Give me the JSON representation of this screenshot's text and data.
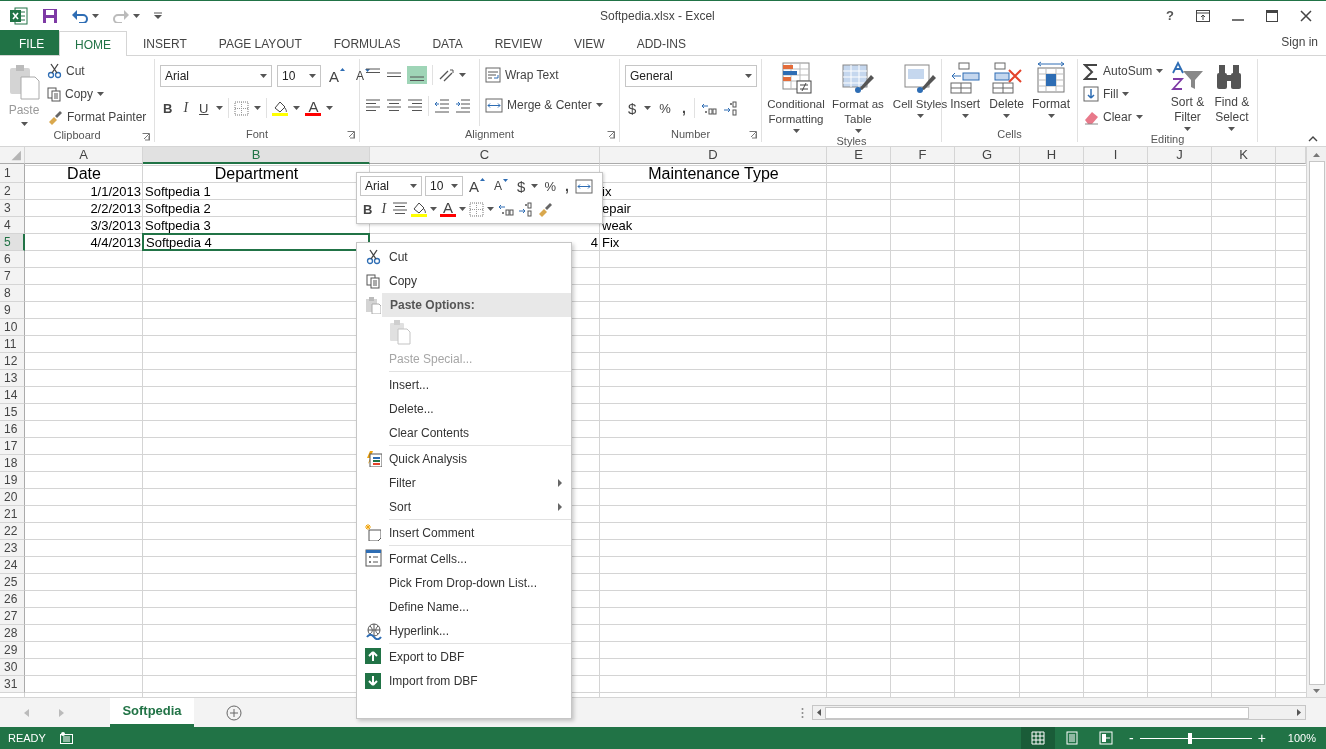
{
  "window": {
    "title": "Softpedia.xlsx - Excel",
    "help": "?"
  },
  "ribbon_tabs": [
    {
      "label": "FILE",
      "kind": "file",
      "selected": false
    },
    {
      "label": "HOME",
      "kind": "tab",
      "selected": true
    },
    {
      "label": "INSERT",
      "kind": "tab",
      "selected": false
    },
    {
      "label": "PAGE LAYOUT",
      "kind": "tab",
      "selected": false
    },
    {
      "label": "FORMULAS",
      "kind": "tab",
      "selected": false
    },
    {
      "label": "DATA",
      "kind": "tab",
      "selected": false
    },
    {
      "label": "REVIEW",
      "kind": "tab",
      "selected": false
    },
    {
      "label": "VIEW",
      "kind": "tab",
      "selected": false
    },
    {
      "label": "ADD-INS",
      "kind": "tab",
      "selected": false
    }
  ],
  "sign_in": "Sign in",
  "ribbon": {
    "clipboard": {
      "label": "Clipboard",
      "paste": "Paste",
      "cut": "Cut",
      "copy": "Copy",
      "format_painter": "Format Painter"
    },
    "font": {
      "label": "Font",
      "font_name": "Arial",
      "font_size": "10",
      "grow": "A",
      "shrink": "A",
      "bold": "B",
      "italic": "I",
      "underline": "U",
      "font_color": "A"
    },
    "alignment": {
      "label": "Alignment",
      "wrap_text": "Wrap Text",
      "merge_center": "Merge & Center"
    },
    "number": {
      "label": "Number",
      "format": "General",
      "currency": "$",
      "percent": "%",
      "comma": ","
    },
    "styles": {
      "label": "Styles",
      "buttons": [
        "Conditional Formatting",
        "Format as Table",
        "Cell Styles"
      ]
    },
    "cells": {
      "label": "Cells",
      "buttons": [
        "Insert",
        "Delete",
        "Format"
      ]
    },
    "editing": {
      "label": "Editing",
      "autosum": "AutoSum",
      "fill": "Fill",
      "clear": "Clear",
      "buttons": [
        "Sort & Filter",
        "Find & Select"
      ]
    }
  },
  "sheet": {
    "columns": [
      {
        "label": "A",
        "selected": false
      },
      {
        "label": "B",
        "selected": true
      },
      {
        "label": "C",
        "selected": false
      },
      {
        "label": "D",
        "selected": false
      },
      {
        "label": "E",
        "selected": false
      },
      {
        "label": "F",
        "selected": false
      },
      {
        "label": "G",
        "selected": false
      },
      {
        "label": "H",
        "selected": false
      },
      {
        "label": "I",
        "selected": false
      },
      {
        "label": "J",
        "selected": false
      },
      {
        "label": "K",
        "selected": false
      }
    ],
    "rows": [
      {
        "header": "1",
        "selected": false,
        "cells": [
          {
            "text": "Date",
            "kind": "heading",
            "selected": false
          },
          {
            "text": "Department",
            "kind": "heading",
            "selected": false
          },
          null,
          {
            "text": "Maintenance Type",
            "kind": "heading",
            "selected": false
          }
        ]
      },
      {
        "header": "2",
        "selected": false,
        "cells": [
          {
            "text": "1/1/2013",
            "kind": "number",
            "selected": false
          },
          {
            "text": "Softpedia 1",
            "kind": "text",
            "selected": false
          },
          null,
          {
            "text": "ix",
            "kind": "text",
            "selected": false
          }
        ]
      },
      {
        "header": "3",
        "selected": false,
        "cells": [
          {
            "text": "2/2/2013",
            "kind": "number",
            "selected": false
          },
          {
            "text": "Softpedia 2",
            "kind": "text",
            "selected": false
          },
          null,
          {
            "text": "epair",
            "kind": "text",
            "selected": false
          }
        ]
      },
      {
        "header": "4",
        "selected": false,
        "cells": [
          {
            "text": "3/3/2013",
            "kind": "number",
            "selected": false
          },
          {
            "text": "Softpedia 3",
            "kind": "text",
            "selected": false
          },
          null,
          {
            "text": "weak",
            "kind": "text",
            "selected": false
          }
        ]
      },
      {
        "header": "5",
        "selected": true,
        "cells": [
          {
            "text": "4/4/2013",
            "kind": "number",
            "selected": false
          },
          {
            "text": "Softpedia 4",
            "kind": "text",
            "selected": true
          },
          {
            "text": "4",
            "kind": "number",
            "selected": false
          },
          {
            "text": "Fix",
            "kind": "text",
            "selected": false
          }
        ]
      },
      {
        "header": "6",
        "selected": false
      },
      {
        "header": "7",
        "selected": false
      },
      {
        "header": "8",
        "selected": false
      },
      {
        "header": "9",
        "selected": false
      },
      {
        "header": "10",
        "selected": false
      },
      {
        "header": "11",
        "selected": false
      },
      {
        "header": "12",
        "selected": false
      },
      {
        "header": "13",
        "selected": false
      },
      {
        "header": "14",
        "selected": false
      },
      {
        "header": "15",
        "selected": false
      },
      {
        "header": "16",
        "selected": false
      },
      {
        "header": "17",
        "selected": false
      },
      {
        "header": "18",
        "selected": false
      },
      {
        "header": "19",
        "selected": false
      },
      {
        "header": "20",
        "selected": false
      },
      {
        "header": "21",
        "selected": false
      },
      {
        "header": "22",
        "selected": false
      },
      {
        "header": "23",
        "selected": false
      },
      {
        "header": "24",
        "selected": false
      },
      {
        "header": "25",
        "selected": false
      },
      {
        "header": "26",
        "selected": false
      },
      {
        "header": "27",
        "selected": false
      },
      {
        "header": "28",
        "selected": false
      },
      {
        "header": "29",
        "selected": false
      },
      {
        "header": "30",
        "selected": false
      },
      {
        "header": "31",
        "selected": false
      }
    ]
  },
  "mini_toolbar": {
    "font_name": "Arial",
    "font_size": "10",
    "grow": "A",
    "shrink": "A",
    "currency": "$",
    "percent": "%",
    "comma": ",",
    "bold": "B",
    "italic": "I",
    "font_color": "A"
  },
  "context_menu": [
    {
      "label": "Cut",
      "kind": "item",
      "disabled": false,
      "submenu": false
    },
    {
      "label": "Copy",
      "kind": "item",
      "disabled": false,
      "submenu": false
    },
    {
      "label": "Paste Options:",
      "kind": "heading",
      "disabled": false,
      "submenu": false
    },
    {
      "kind": "paste-icons",
      "disabled": true
    },
    {
      "label": "Paste Special...",
      "kind": "item",
      "disabled": true,
      "submenu": false
    },
    {
      "label": "Insert...",
      "kind": "item",
      "disabled": false,
      "submenu": false,
      "separator": true
    },
    {
      "label": "Delete...",
      "kind": "item",
      "disabled": false,
      "submenu": false
    },
    {
      "label": "Clear Contents",
      "kind": "item",
      "disabled": false,
      "submenu": false
    },
    {
      "label": "Quick Analysis",
      "kind": "item",
      "disabled": false,
      "submenu": false,
      "separator": true
    },
    {
      "label": "Filter",
      "kind": "item",
      "disabled": false,
      "submenu": true
    },
    {
      "label": "Sort",
      "kind": "item",
      "disabled": false,
      "submenu": true
    },
    {
      "label": "Insert Comment",
      "kind": "item",
      "disabled": false,
      "submenu": false,
      "separator": true
    },
    {
      "label": "Format Cells...",
      "kind": "item",
      "disabled": false,
      "submenu": false,
      "separator": true
    },
    {
      "label": "Pick From Drop-down List...",
      "kind": "item",
      "disabled": false,
      "submenu": false
    },
    {
      "label": "Define Name...",
      "kind": "item",
      "disabled": false,
      "submenu": false
    },
    {
      "label": "Hyperlink...",
      "kind": "item",
      "disabled": false,
      "submenu": false
    },
    {
      "label": "Export to DBF",
      "kind": "item",
      "disabled": false,
      "submenu": false,
      "separator": true
    },
    {
      "label": "Import from DBF",
      "kind": "item",
      "disabled": false,
      "submenu": false
    }
  ],
  "sheet_tabs": [
    {
      "label": "Softpedia",
      "selected": true
    }
  ],
  "status_bar": {
    "status": "READY",
    "views": [
      {
        "selected": true
      },
      {
        "selected": false
      },
      {
        "selected": false
      }
    ],
    "zoom_out": "-",
    "zoom_in": "+",
    "zoom": {
      "level": 0.45
    },
    "zoom_label": "100%"
  }
}
